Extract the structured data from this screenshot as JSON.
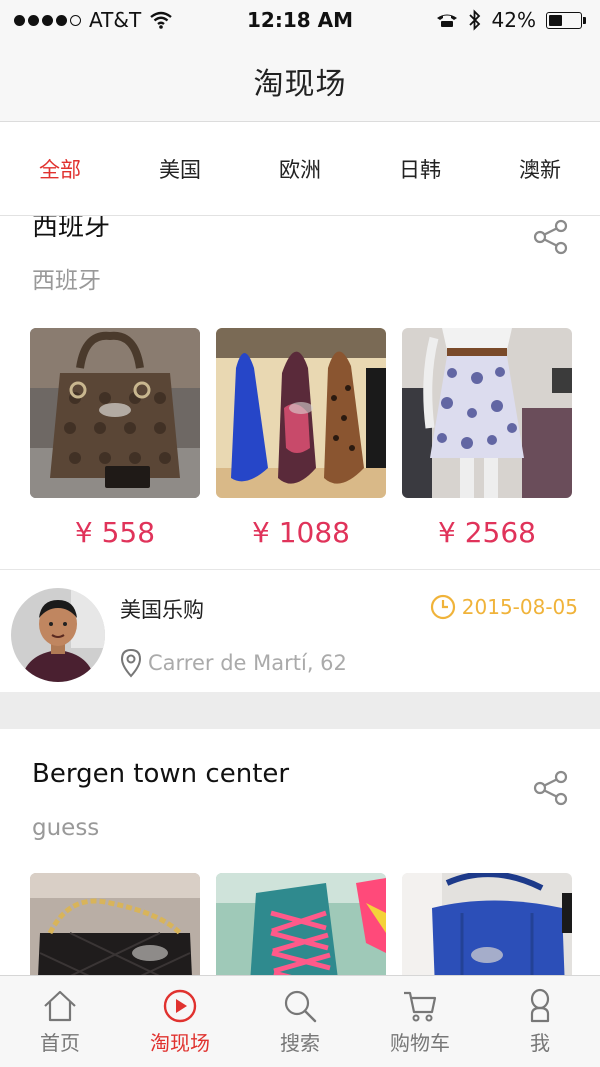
{
  "status_bar": {
    "carrier": "AT&T",
    "time": "12:18 AM",
    "battery": "42%",
    "battery_level": 0.42
  },
  "nav": {
    "title": "淘现场"
  },
  "category_tabs": [
    {
      "label": "全部",
      "active": true
    },
    {
      "label": "美国",
      "active": false
    },
    {
      "label": "欧洲",
      "active": false
    },
    {
      "label": "日韩",
      "active": false
    },
    {
      "label": "澳新",
      "active": false
    }
  ],
  "posts": [
    {
      "title": "西班牙",
      "subtitle": "西班牙",
      "photos": [
        "handbag-photo",
        "high-heels-photo",
        "skirt-photo"
      ],
      "prices": [
        "¥ 558",
        "¥ 1088",
        "¥ 2568"
      ],
      "seller": {
        "name": "美国乐购",
        "date": "2015-08-05",
        "location": "Carrer de Martí, 62"
      }
    },
    {
      "title": "Bergen town center",
      "subtitle": "guess",
      "photos": [
        "quilted-bag-photo",
        "sneakers-photo",
        "blue-bag-photo"
      ]
    }
  ],
  "bottom_tabs": [
    {
      "label": "首页",
      "icon": "home-icon",
      "active": false
    },
    {
      "label": "淘现场",
      "icon": "play-icon",
      "active": true
    },
    {
      "label": "搜索",
      "icon": "search-icon",
      "active": false
    },
    {
      "label": "购物车",
      "icon": "cart-icon",
      "active": false
    },
    {
      "label": "我",
      "icon": "user-icon",
      "active": false
    }
  ],
  "colors": {
    "accent": "#e0322f",
    "price": "#e0335a",
    "date": "#f0b33a"
  }
}
